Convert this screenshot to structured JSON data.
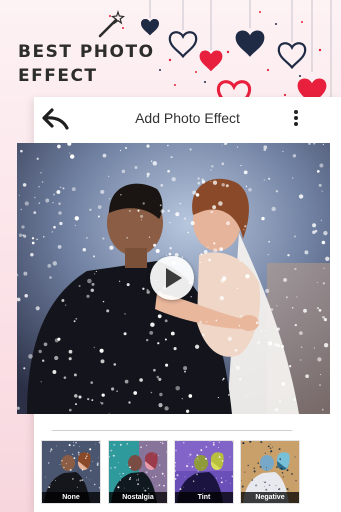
{
  "promo": {
    "line1": "BEST PHOTO",
    "line2": "EFFECT"
  },
  "toolbar": {
    "title": "Add Photo Effect"
  },
  "colors": {
    "heart_red": "#e8203d",
    "heart_navy": "#1f2a44",
    "background": "#fbe3e8",
    "card": "#ffffff"
  },
  "icons": {
    "back": "back-arrow-icon",
    "more": "more-vert-icon",
    "play": "play-icon",
    "wand": "magic-wand-icon",
    "hearts": "heart-icon"
  },
  "effects": [
    {
      "label": "None"
    },
    {
      "label": "Nostalgia"
    },
    {
      "label": "Tint"
    },
    {
      "label": "Negative"
    }
  ]
}
